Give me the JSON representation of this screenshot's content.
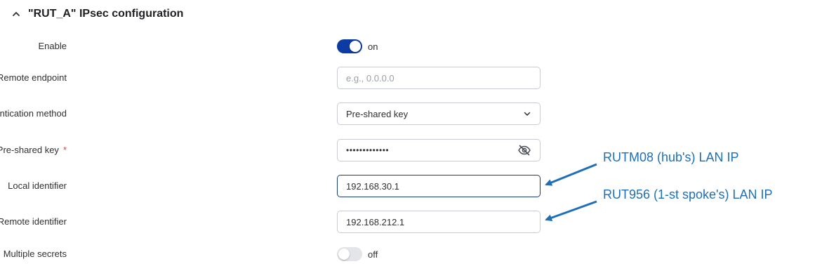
{
  "section": {
    "title": "\"RUT_A\" IPsec configuration",
    "collapse_icon": "chevron-up-icon"
  },
  "fields": {
    "enable": {
      "label": "Enable",
      "state": "on",
      "state_text": "on"
    },
    "remote_endpoint": {
      "label": "Remote endpoint",
      "value": "",
      "placeholder": "e.g., 0.0.0.0"
    },
    "auth_method": {
      "label": "Authentication method",
      "value": "Pre-shared key"
    },
    "psk": {
      "label": "Pre-shared key",
      "required_mark": "*",
      "value": "•••••••••••••",
      "eye_icon": "eye-slash-icon"
    },
    "local_id": {
      "label": "Local identifier",
      "value": "192.168.30.1"
    },
    "remote_id": {
      "label": "Remote identifier",
      "value": "192.168.212.1"
    },
    "multiple_secrets": {
      "label": "Multiple secrets",
      "state": "off",
      "state_text": "off"
    }
  },
  "annotations": {
    "local": "RUTM08 (hub's) LAN IP",
    "remote": "RUT956 (1-st spoke's) LAN IP"
  },
  "colors": {
    "toggle_on": "#0e3aa3",
    "toggle_off": "#e3e5e8",
    "annotation": "#1f6fb8",
    "required": "#d64545",
    "focused_border": "#1b3a7a"
  }
}
